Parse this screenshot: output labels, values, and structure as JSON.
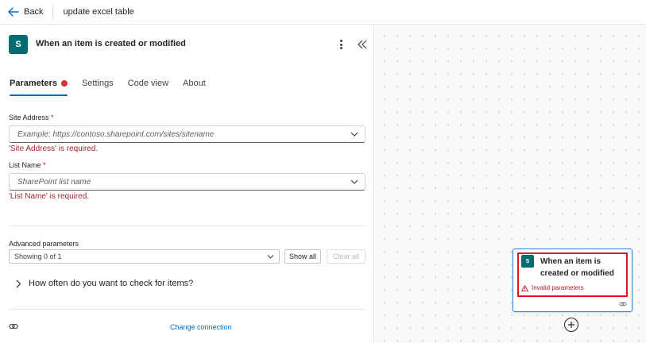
{
  "topbar": {
    "back_label": "Back",
    "flow_title": "update excel table"
  },
  "panel": {
    "logo_text": "S",
    "title": "When an item is created or modified",
    "tabs": [
      {
        "label": "Parameters",
        "active": true,
        "has_error": true
      },
      {
        "label": "Settings",
        "active": false
      },
      {
        "label": "Code view",
        "active": false
      },
      {
        "label": "About",
        "active": false
      }
    ],
    "site_address": {
      "label": "Site Address",
      "required_mark": "*",
      "placeholder": "Example: https://contoso.sharepoint.com/sites/sitename",
      "error": "'Site Address' is required."
    },
    "list_name": {
      "label": "List Name",
      "required_mark": "*",
      "placeholder": "SharePoint list name",
      "error": "'List Name' is required."
    },
    "advanced": {
      "label": "Advanced parameters",
      "selected": "Showing 0 of 1",
      "show_all": "Show all",
      "clear_all": "Clear all"
    },
    "expander_label": "How often do you want to check for items?",
    "change_connection": "Change connection"
  },
  "canvas": {
    "node": {
      "logo_text": "S",
      "title": "When an item is created or modified",
      "warning": "Invalid parameters"
    }
  },
  "colors": {
    "accent": "#0f6cbd",
    "sharepoint": "#036c70",
    "error": "#a4262c",
    "highlight": "#e81123"
  }
}
